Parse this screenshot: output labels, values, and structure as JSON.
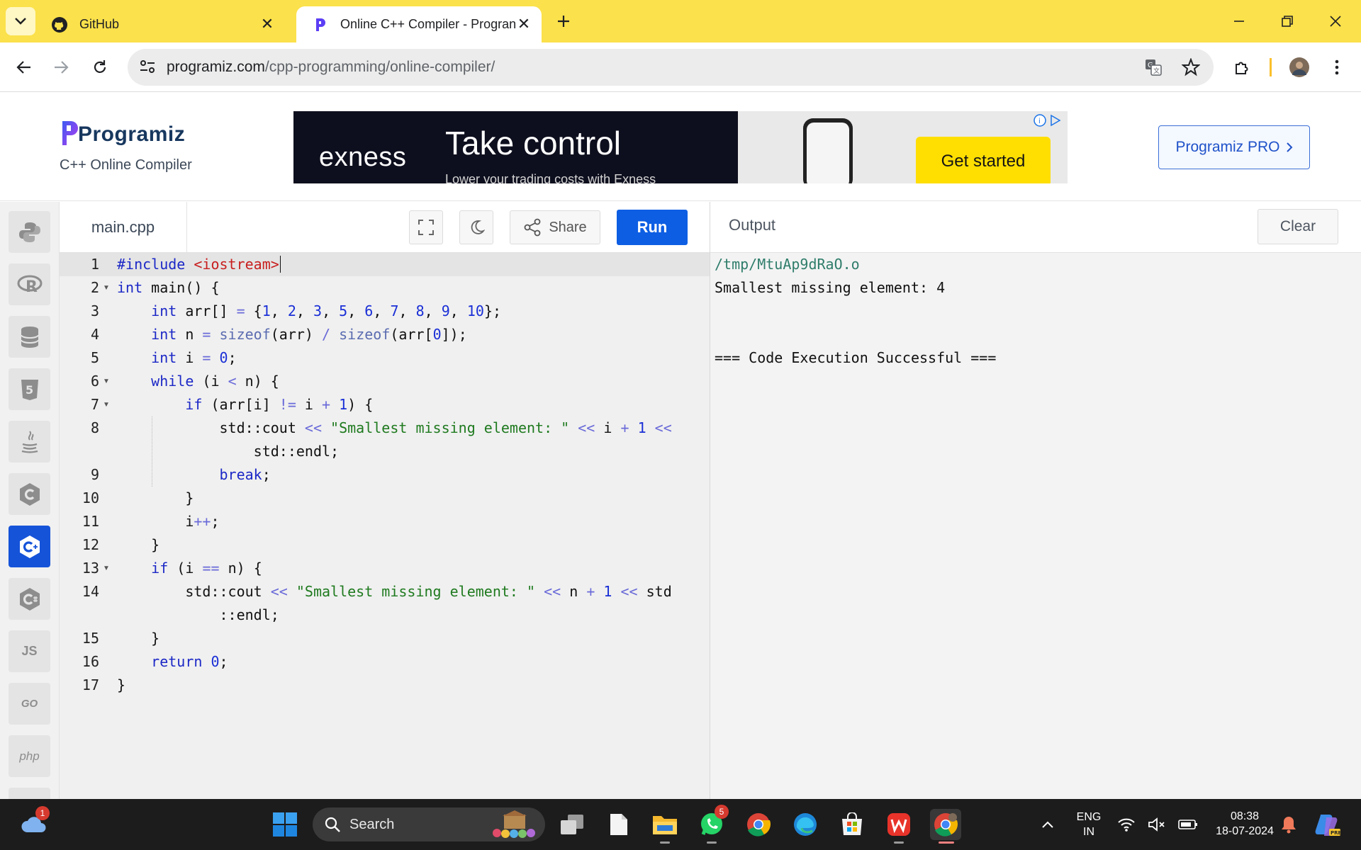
{
  "browser": {
    "tabs": [
      {
        "title": "GitHub",
        "active": false
      },
      {
        "title": "Online C++ Compiler - Progran",
        "active": true
      }
    ],
    "new_tab_icon": "plus-icon",
    "url_host": "programiz.com",
    "url_path": "/cpp-programming/online-compiler/"
  },
  "site": {
    "logo": "Programiz",
    "subtitle": "C++ Online Compiler",
    "pro_button": "Programiz PRO",
    "ad": {
      "brand": "exness",
      "headline": "Take control",
      "subline": "Lower your trading costs with Exness",
      "cta": "Get started"
    }
  },
  "sidebar": {
    "items": [
      {
        "name": "python",
        "label": ""
      },
      {
        "name": "r",
        "label": "R"
      },
      {
        "name": "sql",
        "label": ""
      },
      {
        "name": "html",
        "label": "5"
      },
      {
        "name": "java",
        "label": ""
      },
      {
        "name": "c",
        "label": "C"
      },
      {
        "name": "cpp",
        "label": "C",
        "active": true
      },
      {
        "name": "csharp",
        "label": "C"
      },
      {
        "name": "js",
        "label": "JS"
      },
      {
        "name": "go",
        "label": "GO"
      },
      {
        "name": "php",
        "label": "php"
      }
    ]
  },
  "editor": {
    "filename": "main.cpp",
    "share_label": "Share",
    "run_label": "Run",
    "line_numbers": [
      "1",
      "2",
      "3",
      "4",
      "5",
      "6",
      "7",
      "8",
      "",
      "9",
      "10",
      "11",
      "12",
      "13",
      "14",
      "",
      "15",
      "16",
      "17"
    ],
    "fold_lines": [
      "2",
      "6",
      "7",
      "13"
    ]
  },
  "output": {
    "title": "Output",
    "clear_label": "Clear",
    "lines": [
      "/tmp/MtuAp9dRaO.o",
      "Smallest missing element: 4",
      "",
      "",
      "=== Code Execution Successful ==="
    ]
  },
  "taskbar": {
    "search_placeholder": "Search",
    "whatsapp_badge": "5",
    "weather_badge": "1",
    "lang_top": "ENG",
    "lang_bottom": "IN",
    "time": "08:38",
    "date": "18-07-2024"
  },
  "colors": {
    "tabbar": "#fbe14b",
    "run_button": "#0d5ee3",
    "active_sidebar": "#1553d9"
  }
}
